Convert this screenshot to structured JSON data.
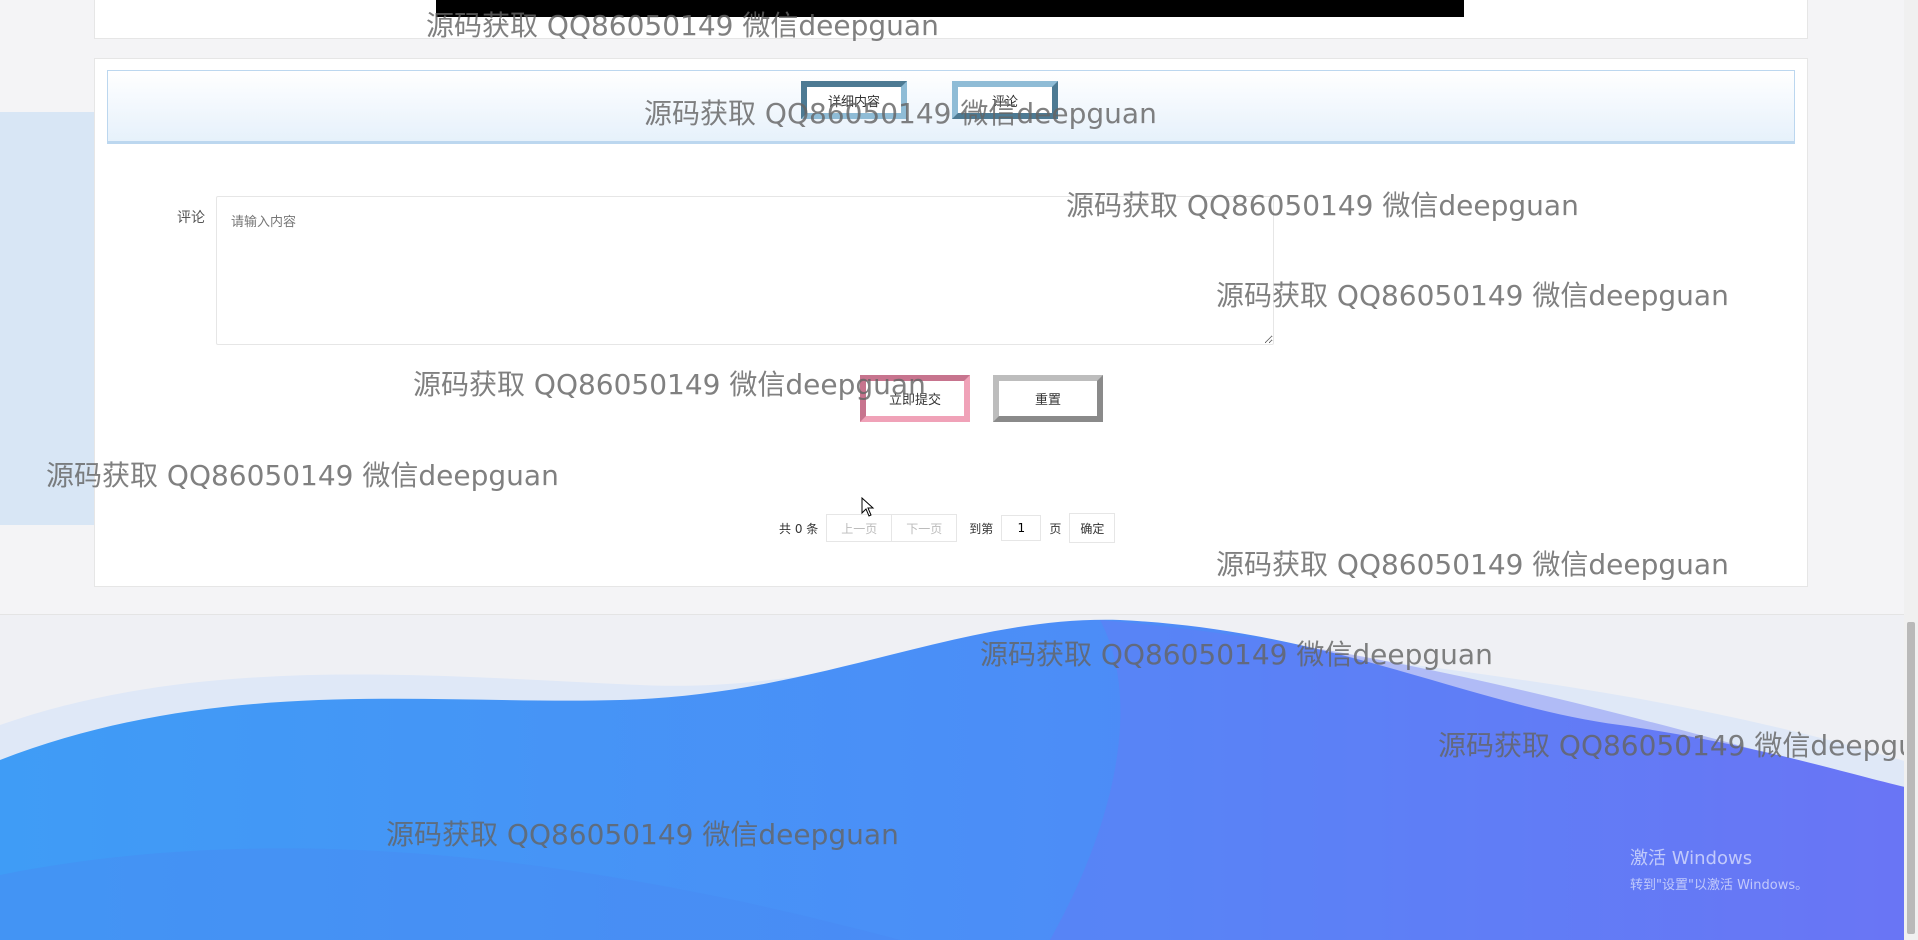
{
  "tabs": [
    {
      "label": "详细内容"
    },
    {
      "label": "评论"
    }
  ],
  "comment": {
    "label": "评论",
    "placeholder": "请输入内容"
  },
  "actions": {
    "submit_label": "立即提交",
    "reset_label": "重置"
  },
  "pager": {
    "total": "共 0 条",
    "prev_label": "上一页",
    "next_label": "下一页",
    "goto_label": "到第",
    "page_value": "1",
    "page_word": "页",
    "confirm_label": "确定"
  },
  "watermark": "源码获取 QQ86050149 微信deepguan",
  "activate_windows": {
    "title": "激活 Windows",
    "subtitle": "转到\"设置\"以激活 Windows。"
  },
  "colors": {
    "wave_primary": "#4a8ff7",
    "wave_secondary": "#6f7cf7",
    "tab_border": "#bcd7ef"
  }
}
